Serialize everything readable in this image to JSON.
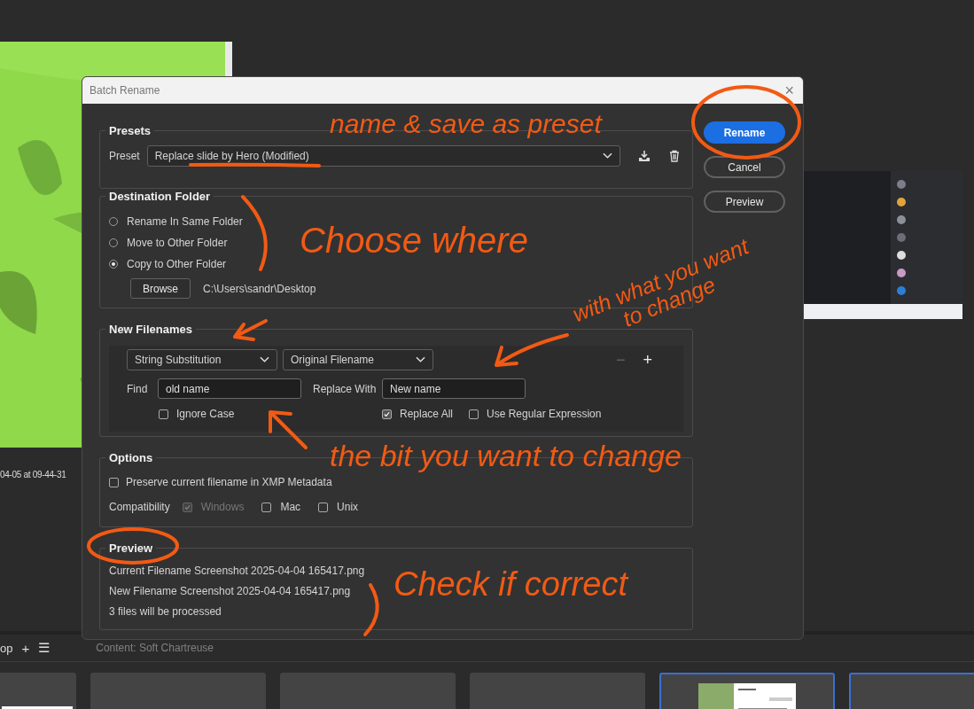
{
  "viewer": {
    "caption": "04-05 at 09-44-31",
    "tab": {
      "label": "op",
      "add": "+",
      "menu": "☰"
    },
    "content_label": "Content: Soft Chartreuse",
    "thumbnails": [
      {
        "kind": "document",
        "selected": false
      },
      {
        "kind": "blank",
        "selected": false
      },
      {
        "kind": "blank",
        "selected": false
      },
      {
        "kind": "blank",
        "selected": false
      },
      {
        "kind": "screenshot",
        "selected": true
      },
      {
        "kind": "blank",
        "selected": true
      }
    ]
  },
  "dialog": {
    "title": "Batch Rename",
    "close": "×",
    "buttons": [
      {
        "label": "Rename",
        "primary": true
      },
      {
        "label": "Cancel",
        "primary": false
      },
      {
        "label": "Preview",
        "primary": false
      }
    ],
    "presets": {
      "heading": "Presets",
      "label": "Preset",
      "value": "Replace slide by Hero (Modified)"
    },
    "destination": {
      "heading": "Destination Folder",
      "options": [
        {
          "label": "Rename In Same Folder",
          "selected": false
        },
        {
          "label": "Move to Other Folder",
          "selected": false
        },
        {
          "label": "Copy to Other Folder",
          "selected": true
        }
      ],
      "browse": "Browse",
      "path": "C:\\Users\\sandr\\Desktop"
    },
    "new_filenames": {
      "heading": "New Filenames",
      "type": "String Substitution",
      "source": "Original Filename",
      "remove": "−",
      "add": "+",
      "find_label": "Find",
      "find_value": "old name",
      "replace_label": "Replace With",
      "replace_value": "New name",
      "checks": [
        {
          "label": "Ignore Case",
          "checked": false
        },
        {
          "label": "Replace All",
          "checked": true
        },
        {
          "label": "Use Regular Expression",
          "checked": false
        }
      ]
    },
    "options": {
      "heading": "Options",
      "preserve": {
        "label": "Preserve current filename in XMP Metadata",
        "checked": false
      },
      "compat_label": "Compatibility",
      "compat": [
        {
          "label": "Windows",
          "checked": true,
          "disabled": true
        },
        {
          "label": "Mac",
          "checked": false,
          "disabled": false
        },
        {
          "label": "Unix",
          "checked": false,
          "disabled": false
        }
      ]
    },
    "preview": {
      "heading": "Preview",
      "lines": [
        "Current Filename Screenshot 2025-04-04 165417.png",
        "New Filename Screenshot 2025-04-04 165417.png",
        "3 files will be processed"
      ]
    }
  },
  "annotations": [
    "name & save as preset",
    "Choose where",
    "with what you want to change",
    "the bit you want to change",
    "Check if correct"
  ]
}
